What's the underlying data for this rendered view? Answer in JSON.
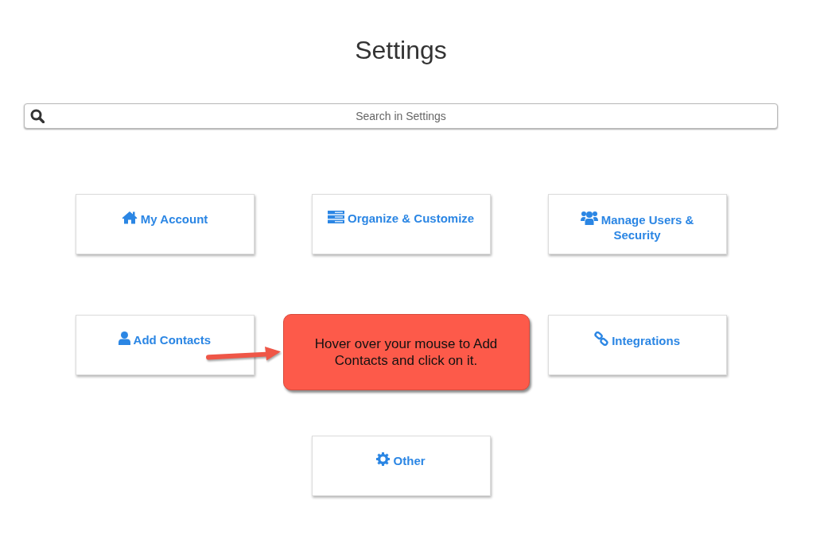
{
  "page": {
    "title": "Settings"
  },
  "search": {
    "placeholder": "Search in Settings"
  },
  "tiles": [
    {
      "kind": "card",
      "label": "My Account"
    },
    {
      "kind": "card",
      "label": "Organize & Customize"
    },
    {
      "kind": "card",
      "label": "Manage Users & Security"
    },
    {
      "kind": "card",
      "label": "Add Contacts"
    },
    {
      "kind": "callout",
      "text": "Hover over your mouse to Add Contacts and click on it."
    },
    {
      "kind": "card",
      "label": "Integrations"
    },
    {
      "kind": "card",
      "label": "Other"
    }
  ]
}
